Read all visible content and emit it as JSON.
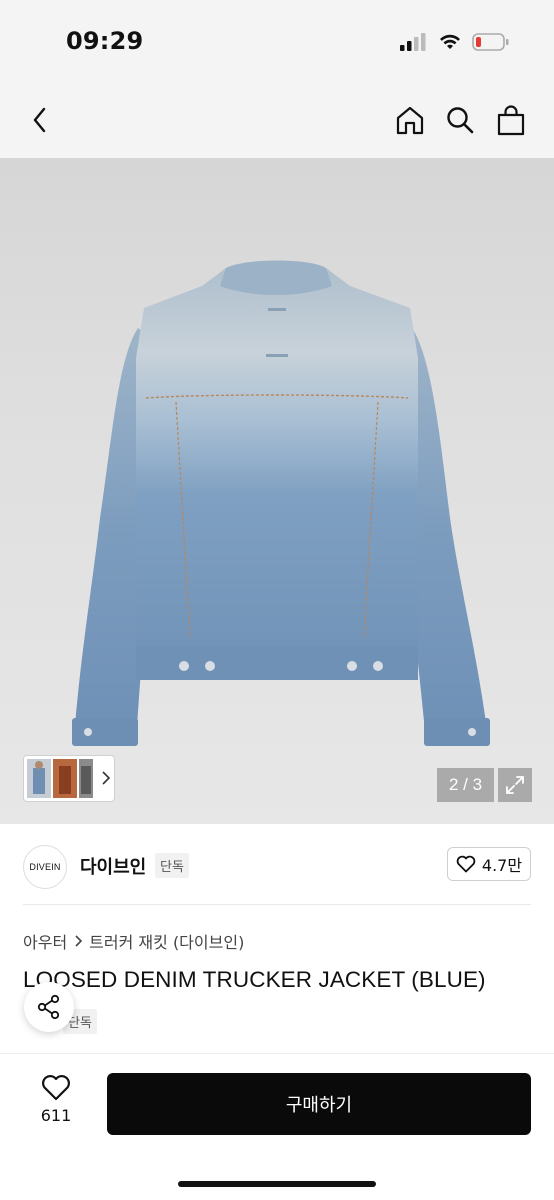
{
  "status": {
    "time": "09:29"
  },
  "gallery": {
    "page_indicator": "2 / 3"
  },
  "brand": {
    "logo_text": "DIVEIN",
    "name": "다이브인",
    "badge": "단독",
    "likes": "4.7만"
  },
  "breadcrumb": {
    "category": "아우터",
    "subcategory": "트러커 재킷 (다이브인)"
  },
  "product": {
    "title": "LOOSED DENIM TRUCKER JACKET (BLUE)",
    "badge": "단독"
  },
  "bottom": {
    "wish_count": "611",
    "buy_label": "구매하기"
  },
  "colors": {
    "denim_light": "#c3d0da",
    "denim_mid": "#7c9bbd",
    "denim_dark": "#5a7ea3"
  }
}
